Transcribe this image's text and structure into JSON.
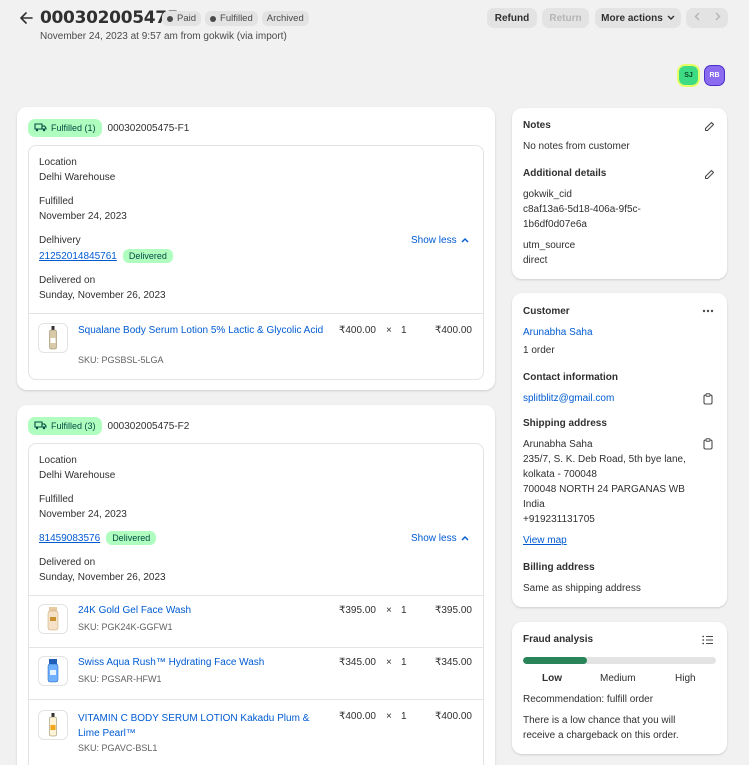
{
  "header": {
    "title": "000302005475",
    "badges": [
      {
        "label": "Paid",
        "dot": true
      },
      {
        "label": "Fulfilled",
        "dot": true
      },
      {
        "label": "Archived",
        "dot": false
      }
    ],
    "subtitle": "November 24, 2023 at 9:57 am from gokwik (via import)",
    "refund_label": "Refund",
    "return_label": "Return",
    "more_actions_label": "More actions"
  },
  "avatars": [
    "SJ",
    "RB"
  ],
  "fulfillments": [
    {
      "badge": "Fulfilled (1)",
      "id": "000302005475-F1",
      "location_label": "Location",
      "location": "Delhi Warehouse",
      "fulfilled_label": "Fulfilled",
      "fulfilled_date": "November 24, 2023",
      "carrier": "Delhivery",
      "tracking": "21252014845761",
      "status": "Delivered",
      "show_less": "Show less",
      "delivered_label": "Delivered on",
      "delivered_date": "Sunday, November 26, 2023",
      "items": [
        {
          "name": "Squalane Body Serum Lotion 5% Lactic & Glycolic Acid",
          "sku": "SKU: PGSBSL-5LGA",
          "price": "₹400.00",
          "times": "×",
          "qty": "1",
          "total": "₹400.00"
        }
      ]
    },
    {
      "badge": "Fulfilled (3)",
      "id": "000302005475-F2",
      "location_label": "Location",
      "location": "Delhi Warehouse",
      "fulfilled_label": "Fulfilled",
      "fulfilled_date": "November 24, 2023",
      "tracking": "81459083576",
      "status": "Delivered",
      "show_less": "Show less",
      "delivered_label": "Delivered on",
      "delivered_date": "Sunday, November 26, 2023",
      "items": [
        {
          "name": "24K Gold Gel Face Wash",
          "sku": "SKU: PGK24K-GGFW1",
          "price": "₹395.00",
          "times": "×",
          "qty": "1",
          "total": "₹395.00"
        },
        {
          "name": "Swiss Aqua Rush™ Hydrating Face Wash",
          "sku": "SKU: PGSAR-HFW1",
          "price": "₹345.00",
          "times": "×",
          "qty": "1",
          "total": "₹345.00"
        },
        {
          "name": "VITAMIN C BODY SERUM LOTION Kakadu Plum & Lime Pearl™",
          "sku": "SKU: PGAVC-BSL1",
          "price": "₹400.00",
          "times": "×",
          "qty": "1",
          "total": "₹400.00"
        }
      ]
    }
  ],
  "notes": {
    "title": "Notes",
    "text": "No notes from customer",
    "additional_title": "Additional details",
    "key1": "gokwik_cid",
    "val1_line1": "c8af13a6-5d18-406a-9f5c-",
    "val1_line2": "1b6df0d07e6a",
    "key2": "utm_source",
    "val2": "direct"
  },
  "customer": {
    "title": "Customer",
    "name": "Arunabhа Saha",
    "orders": "1 order",
    "contact_title": "Contact information",
    "email": "splitblitz@gmail.com",
    "shipping_title": "Shipping address",
    "address_lines": [
      "Arunabha Saha",
      "235/7, S. K. Deb Road, 5th bye lane,",
      "kolkata - 700048",
      "700048 NORTH 24 PARGANAS WB",
      "India",
      "+919231131705"
    ],
    "view_map": "View map",
    "billing_title": "Billing address",
    "billing_text": "Same as shipping address"
  },
  "fraud": {
    "title": "Fraud analysis",
    "level": 0.33,
    "low": "Low",
    "medium": "Medium",
    "high": "High",
    "recommendation": "Recommendation: fulfill order",
    "desc_line1": "There is a low chance that you will",
    "desc_line2": "receive a chargeback on this order."
  }
}
